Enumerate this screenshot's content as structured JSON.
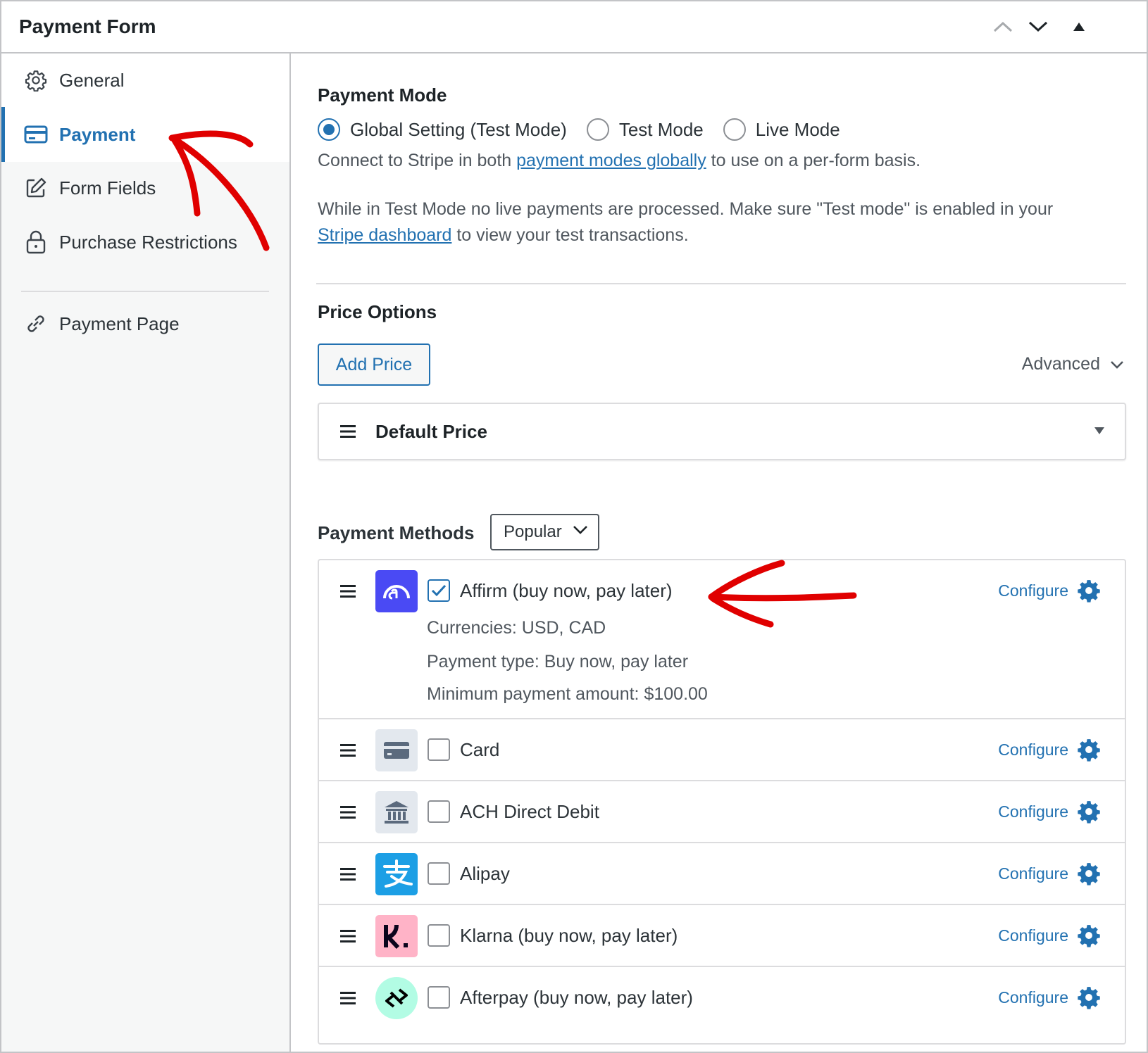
{
  "header": {
    "title": "Payment Form"
  },
  "sidebar": {
    "items": [
      {
        "label": "General",
        "icon": "gear-icon"
      },
      {
        "label": "Payment",
        "icon": "credit-card-icon"
      },
      {
        "label": "Form Fields",
        "icon": "edit-icon"
      },
      {
        "label": "Purchase Restrictions",
        "icon": "lock-icon"
      },
      {
        "label": "Payment Page",
        "icon": "link-icon"
      }
    ]
  },
  "payment_mode": {
    "title": "Payment Mode",
    "options": [
      {
        "label": "Global Setting (Test Mode)",
        "selected": true
      },
      {
        "label": "Test Mode",
        "selected": false
      },
      {
        "label": "Live Mode",
        "selected": false
      }
    ],
    "connect_prefix": "Connect to Stripe in both ",
    "connect_link": "payment modes globally",
    "connect_suffix": " to use on a per-form basis.",
    "test_line1": "While in Test Mode no live payments are processed. Make sure \"Test mode\" is enabled in your",
    "test_link": "Stripe dashboard",
    "test_line2_suffix": " to view your test transactions."
  },
  "price_options": {
    "title": "Price Options",
    "add_button": "Add Price",
    "advanced_label": "Advanced",
    "default_price_label": "Default Price"
  },
  "payment_methods": {
    "title": "Payment Methods",
    "filter_value": "Popular",
    "configure_label": "Configure",
    "items": [
      {
        "name": "Affirm (buy now, pay later)",
        "checked": true,
        "logo": "affirm-logo",
        "color": "#4a4af4",
        "details": [
          "Currencies: USD, CAD",
          "Payment type: Buy now, pay later",
          "Minimum payment amount: $100.00"
        ]
      },
      {
        "name": "Card",
        "checked": false,
        "logo": "card-logo",
        "color": "#e3e8ee"
      },
      {
        "name": "ACH Direct Debit",
        "checked": false,
        "logo": "bank-logo",
        "color": "#e3e8ee"
      },
      {
        "name": "Alipay",
        "checked": false,
        "logo": "alipay-logo",
        "color": "#1c9fe5"
      },
      {
        "name": "Klarna (buy now, pay later)",
        "checked": false,
        "logo": "klarna-logo",
        "color": "#ffb3c7"
      },
      {
        "name": "Afterpay (buy now, pay later)",
        "checked": false,
        "logo": "afterpay-logo",
        "color": "#b2fce4"
      }
    ]
  },
  "colors": {
    "accent": "#2271b1",
    "annotation": "#e00000"
  }
}
